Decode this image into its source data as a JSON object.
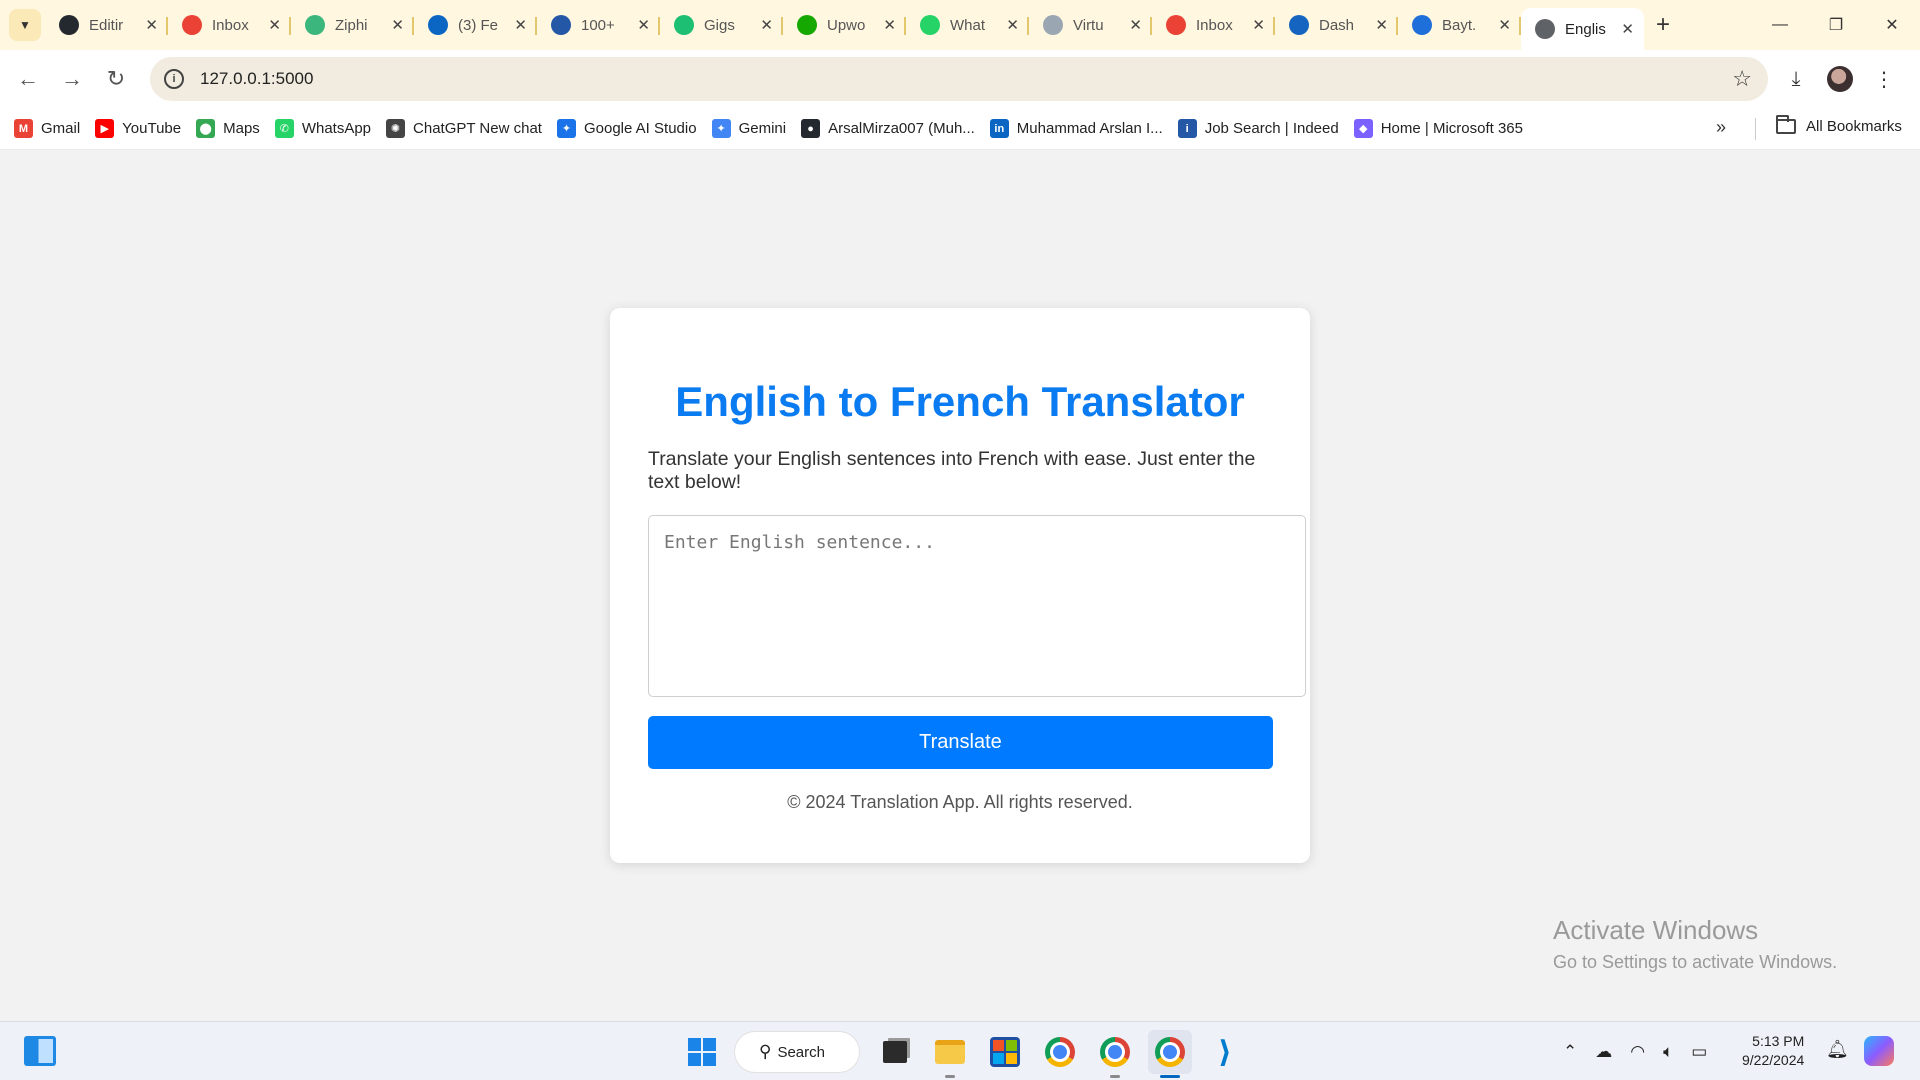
{
  "browser": {
    "tabs": [
      {
        "title": "Editir",
        "favicon": "github-icon",
        "color": "#24292f"
      },
      {
        "title": "Inbox",
        "favicon": "gmail-icon",
        "color": "#ea4335"
      },
      {
        "title": "Ziphi",
        "favicon": "ziphi-icon",
        "color": "#3bb77e"
      },
      {
        "title": "(3) Fe",
        "favicon": "linkedin-icon",
        "color": "#0a66c2"
      },
      {
        "title": "100+",
        "favicon": "indeed-icon",
        "color": "#2557a7"
      },
      {
        "title": "Gigs",
        "favicon": "fiverr-icon",
        "color": "#1dbf73"
      },
      {
        "title": "Upwo",
        "favicon": "upwork-icon",
        "color": "#14a800"
      },
      {
        "title": "What",
        "favicon": "whatsapp-icon",
        "color": "#25d366"
      },
      {
        "title": "Virtu",
        "favicon": "document-icon",
        "color": "#9aa6b2"
      },
      {
        "title": "Inbox",
        "favicon": "gmail-icon",
        "color": "#ea4335"
      },
      {
        "title": "Dash",
        "favicon": "dashboard-icon",
        "color": "#1565c0"
      },
      {
        "title": "Bayt.",
        "favicon": "bayt-icon",
        "color": "#1e6fd9"
      },
      {
        "title": "Englis",
        "favicon": "globe-icon",
        "color": "#5f6368",
        "active": true
      }
    ],
    "url": "127.0.0.1:5000",
    "bookmarks": [
      {
        "label": "Gmail",
        "icon": "gmail-icon",
        "color": "#ea4335",
        "glyph": "M"
      },
      {
        "label": "YouTube",
        "icon": "youtube-icon",
        "color": "#ff0000",
        "glyph": "▶"
      },
      {
        "label": "Maps",
        "icon": "maps-icon",
        "color": "#34a853",
        "glyph": "⬤"
      },
      {
        "label": "WhatsApp",
        "icon": "whatsapp-icon",
        "color": "#25d366",
        "glyph": "✆"
      },
      {
        "label": "ChatGPT New chat",
        "icon": "chatgpt-icon",
        "color": "#444444",
        "glyph": "✺"
      },
      {
        "label": "Google AI Studio",
        "icon": "ai-studio-icon",
        "color": "#1a73e8",
        "glyph": "✦"
      },
      {
        "label": "Gemini",
        "icon": "gemini-icon",
        "color": "#4285f4",
        "glyph": "✦"
      },
      {
        "label": "ArsalMirza007 (Muh...",
        "icon": "github-icon",
        "color": "#24292f",
        "glyph": "●"
      },
      {
        "label": "Muhammad Arslan I...",
        "icon": "linkedin-icon",
        "color": "#0a66c2",
        "glyph": "in"
      },
      {
        "label": "Job Search | Indeed",
        "icon": "indeed-icon",
        "color": "#2557a7",
        "glyph": "i"
      },
      {
        "label": "Home | Microsoft 365",
        "icon": "microsoft365-icon",
        "color": "#7b61ff",
        "glyph": "◆"
      }
    ],
    "all_bookmarks_label": "All Bookmarks"
  },
  "page": {
    "title": "English to French Translator",
    "description": "Translate your English sentences into French with ease. Just enter the text below!",
    "input_placeholder": "Enter English sentence...",
    "input_value": "",
    "translate_label": "Translate",
    "footer": "© 2024 Translation App. All rights reserved.",
    "accent_color": "#007bff"
  },
  "watermark": {
    "line1": "Activate Windows",
    "line2": "Go to Settings to activate Windows."
  },
  "taskbar": {
    "search_label": "Search",
    "time": "5:13 PM",
    "date": "9/22/2024"
  }
}
